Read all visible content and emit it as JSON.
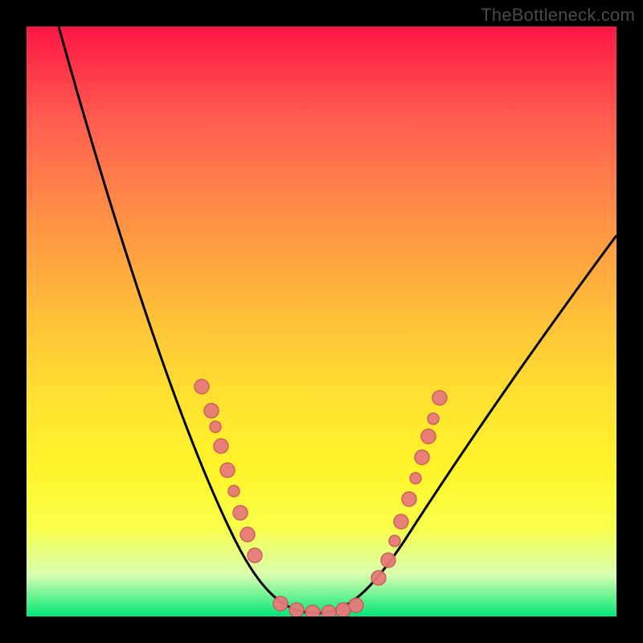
{
  "watermark": "TheBottleneck.com",
  "chart_data": {
    "type": "line",
    "title": "",
    "xlabel": "",
    "ylabel": "",
    "xlim": [
      0,
      100
    ],
    "ylim": [
      0,
      100
    ],
    "bg_gradient_stops": [
      "#ff1744",
      "#ff7a4a",
      "#ffe030",
      "#f8ff4a",
      "#00e676"
    ],
    "series": [
      {
        "name": "bottleneck-curve",
        "type": "line",
        "color": "#000",
        "x_values": [
          5,
          8,
          11,
          14,
          17,
          20,
          23,
          26,
          29,
          32,
          35,
          38,
          40,
          42,
          44,
          46,
          48,
          50,
          52,
          55,
          58,
          62,
          66,
          70,
          74,
          78,
          82,
          86,
          90,
          94,
          98
        ],
        "y_values": [
          100,
          93,
          86,
          79,
          72,
          65,
          58,
          51,
          44,
          37,
          30,
          22,
          16,
          11,
          7,
          4,
          2,
          1,
          1,
          2,
          5,
          10,
          17,
          24,
          31,
          38,
          44,
          50,
          56,
          61,
          66
        ]
      },
      {
        "name": "left-markers",
        "type": "scatter",
        "color": "#e77a7a",
        "x_values": [
          32,
          34,
          36,
          37,
          38,
          40,
          41,
          42
        ],
        "y_values": [
          38,
          34,
          30,
          26,
          22,
          18,
          14,
          11
        ]
      },
      {
        "name": "bottom-markers",
        "type": "scatter",
        "color": "#e77a7a",
        "x_values": [
          44,
          46,
          48,
          50,
          52,
          53
        ],
        "y_values": [
          2,
          1,
          1,
          1,
          1,
          2
        ]
      },
      {
        "name": "right-markers",
        "type": "scatter",
        "color": "#e77a7a",
        "x_values": [
          56,
          58,
          59,
          60,
          62,
          63,
          64,
          65
        ],
        "y_values": [
          6,
          11,
          15,
          19,
          24,
          28,
          33,
          37
        ]
      }
    ]
  }
}
